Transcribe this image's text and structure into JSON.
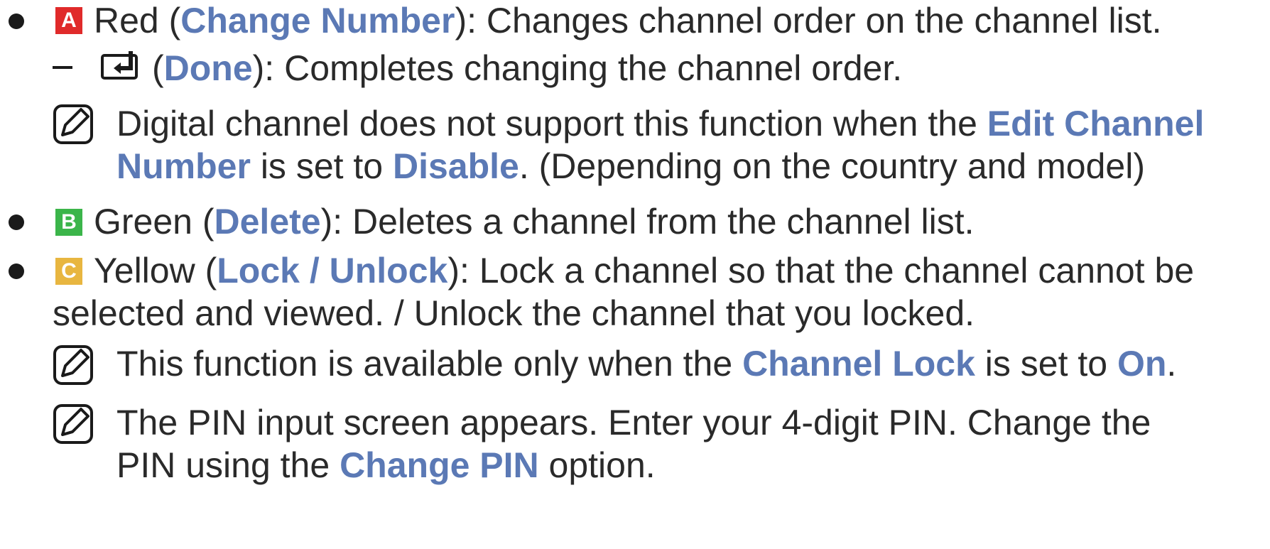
{
  "colors": {
    "accent": "#5b79b5",
    "red_key": "#e02a2a",
    "green_key": "#3bb54a",
    "yellow_key": "#e8b640",
    "text": "#2a2a2a"
  },
  "icons": {
    "note": "note-icon",
    "enter": "enter-icon",
    "bullet": "bullet-icon"
  },
  "items": {
    "red": {
      "key": "A",
      "color_word": "Red (",
      "action": "Change Number",
      "desc": "): Changes channel order on the channel list."
    },
    "done": {
      "pre": "(",
      "action": "Done",
      "desc": "): Completes changing the channel order."
    },
    "note1": {
      "pre": "Digital channel does not support this function when the ",
      "hl1": "Edit Channel",
      "hl1b": "Number",
      "mid": " is set to ",
      "hl2": "Disable",
      "post": ". (Depending on the country and model)"
    },
    "green": {
      "key": "B",
      "color_word": "Green (",
      "action": "Delete",
      "desc": "): Deletes a channel from the channel list."
    },
    "yellow": {
      "key": "C",
      "color_word": "Yellow (",
      "action": "Lock / Unlock",
      "desc": "): Lock a channel so that the channel cannot be",
      "desc2": "selected and viewed. / Unlock the channel that you locked."
    },
    "note2": {
      "pre": "This function is available only when the ",
      "hl1": "Channel Lock",
      "mid": " is set to ",
      "hl2": "On",
      "post": "."
    },
    "note3": {
      "line1": "The PIN input screen appears. Enter your 4-digit PIN. Change the",
      "pre2": "PIN using the ",
      "hl": "Change PIN",
      "post2": " option."
    }
  }
}
